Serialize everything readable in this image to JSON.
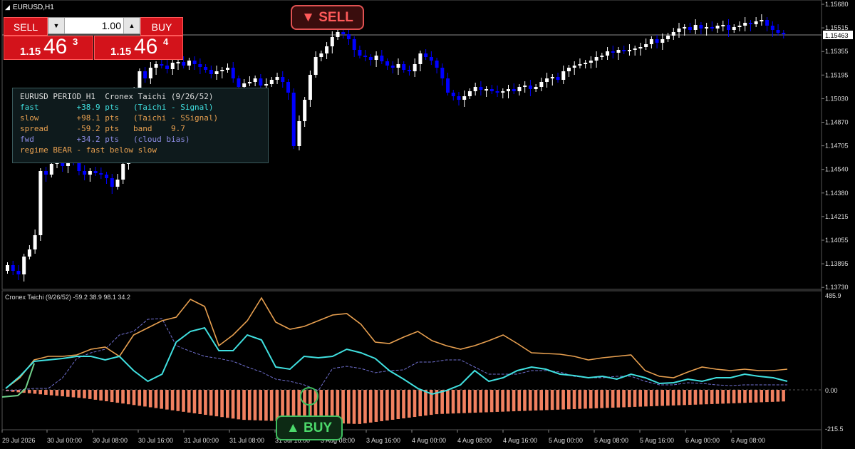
{
  "chart_title": "EURUSD,H1",
  "trade_panel": {
    "sell_label": "SELL",
    "buy_label": "BUY",
    "lot_value": "1.00",
    "lot_down": "▼",
    "lot_up": "▲",
    "bid_prefix": "1.15",
    "bid_big": "46",
    "bid_sup": "3",
    "ask_prefix": "1.15",
    "ask_big": "46",
    "ask_sup": "4"
  },
  "info_panel": {
    "line1": "EURUSD PERIOD_H1  Cronex Taichi (9/26/52)",
    "fast_label": "fast",
    "fast_value": "+38.9 pts",
    "fast_desc": "(Taichi - Signal)",
    "slow_label": "slow",
    "slow_value": "+98.1 pts",
    "slow_desc": "(Taichi - SSignal)",
    "spread_label": "spread",
    "spread_value": "-59.2 pts",
    "band_label": "band",
    "band_value": "9.7",
    "fwd_label": "fwd",
    "fwd_value": "+34.2 pts",
    "fwd_desc": "(cloud bias)",
    "regime": "regime BEAR - fast below slow"
  },
  "signals": {
    "sell": "▼ SELL",
    "buy": "▲ BUY"
  },
  "indicator_label": "Cronex Taichi (9/26/52) -59.2 38.9 98.1 34.2",
  "price_axis": [
    "1.15680",
    "1.15515",
    "1.15355",
    "1.15195",
    "1.15030",
    "1.14870",
    "1.14705",
    "1.14540",
    "1.14380",
    "1.14215",
    "1.14055",
    "1.13895",
    "1.13730"
  ],
  "current_price": "1.15463",
  "indicator_axis": {
    "top": "485.9",
    "zero": "0.00",
    "bottom": "-215.5"
  },
  "time_axis": [
    "29 Jul 2026",
    "30 Jul 00:00",
    "30 Jul 08:00",
    "30 Jul 16:00",
    "31 Jul 00:00",
    "31 Jul 08:00",
    "31 Jul 16:00",
    "3 Aug 08:00",
    "3 Aug 16:00",
    "4 Aug 00:00",
    "4 Aug 08:00",
    "4 Aug 16:00",
    "5 Aug 00:00",
    "5 Aug 08:00",
    "5 Aug 16:00",
    "6 Aug 00:00",
    "6 Aug 08:00"
  ],
  "colors": {
    "bull": "#ffffff",
    "bear": "#0000ff",
    "fast_line": "#40e0e0",
    "slow_line": "#e8a050",
    "fwd_line": "#7070d0",
    "histogram": "#f08060",
    "sell": "#ff5a5a",
    "buy": "#4cd96b"
  }
}
